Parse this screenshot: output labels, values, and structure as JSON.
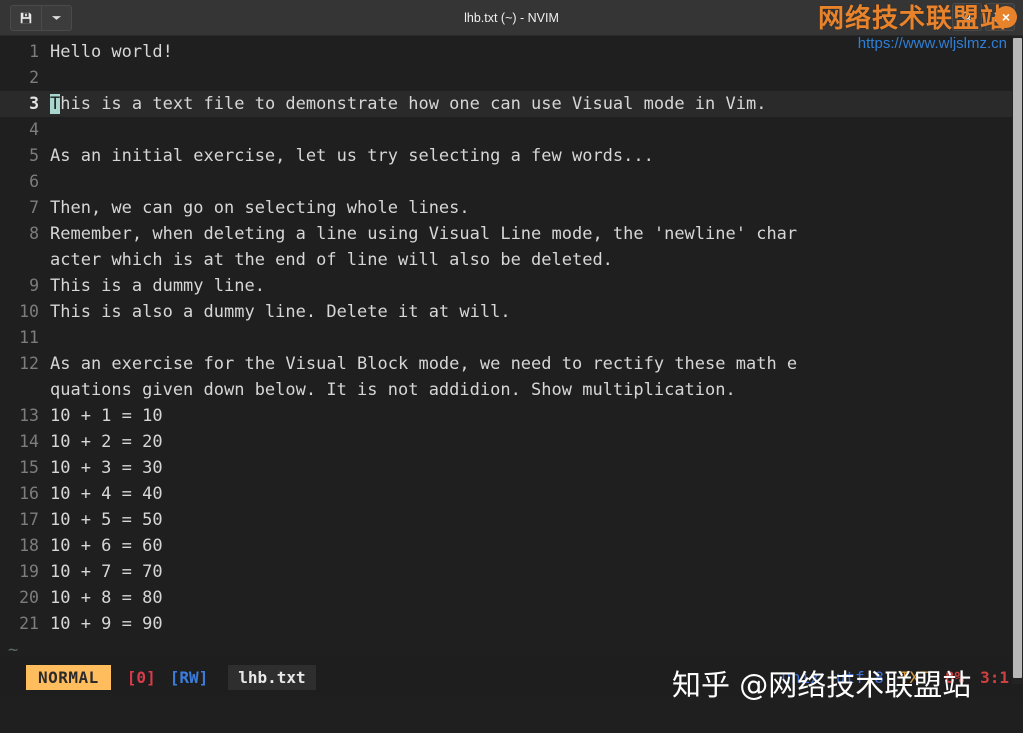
{
  "titlebar": {
    "title": "lhb.txt (~) - NVIM",
    "save_icon": "save-floppy-icon",
    "dropdown_icon": "chevron-down-icon",
    "search_icon": "search-icon",
    "menu_icon": "hamburger-menu-icon",
    "close_label": "×"
  },
  "watermark": {
    "brand_cn": "网络技术联盟站",
    "url": "https://www.wljslmz.cn",
    "bottom": "知乎 @网络技术联盟站"
  },
  "editor": {
    "cursor_char": "T",
    "cursor_line": 3,
    "tilde": "~",
    "lines": [
      {
        "num": "1",
        "text": "Hello world!"
      },
      {
        "num": "2",
        "text": ""
      },
      {
        "num": "3",
        "text": "This is a text file to demonstrate how one can use Visual mode in Vim."
      },
      {
        "num": "4",
        "text": ""
      },
      {
        "num": "5",
        "text": "As an initial exercise, let us try selecting a few words..."
      },
      {
        "num": "6",
        "text": ""
      },
      {
        "num": "7",
        "text": "Then, we can go on selecting whole lines."
      },
      {
        "num": "8",
        "text": "Remember, when deleting a line using Visual Line mode, the 'newline' char"
      },
      {
        "num": "",
        "text": "acter which is at the end of line will also be deleted."
      },
      {
        "num": "9",
        "text": "This is a dummy line."
      },
      {
        "num": "10",
        "text": "This is also a dummy line. Delete it at will."
      },
      {
        "num": "11",
        "text": ""
      },
      {
        "num": "12",
        "text": "As an exercise for the Visual Block mode, we need to rectify these math e"
      },
      {
        "num": "",
        "text": "quations given down below. It is not addidion. Show multiplication."
      },
      {
        "num": "13",
        "text": "10 + 1 = 10"
      },
      {
        "num": "14",
        "text": "10 + 2 = 20"
      },
      {
        "num": "15",
        "text": "10 + 3 = 30"
      },
      {
        "num": "16",
        "text": "10 + 4 = 40"
      },
      {
        "num": "17",
        "text": "10 + 5 = 50"
      },
      {
        "num": "18",
        "text": "10 + 6 = 60"
      },
      {
        "num": "19",
        "text": "10 + 7 = 70"
      },
      {
        "num": "20",
        "text": "10 + 8 = 80"
      },
      {
        "num": "21",
        "text": "10 + 9 = 90"
      }
    ]
  },
  "statusline": {
    "mode": "NORMAL",
    "count": "[0]",
    "readwrite": "[RW]",
    "filename": "lhb.txt",
    "fileformat": "unix",
    "encoding": "utf-8",
    "filetype": "TXT",
    "percent": "8%",
    "position": "3:1"
  },
  "colors": {
    "accent_orange": "#e8832b",
    "mode_orange": "#ffbd5e",
    "link_blue": "#2f7fd6",
    "cursor_mint": "#a9d6cf",
    "count_red": "#d63c4a",
    "rw_blue": "#3b7ddd"
  }
}
